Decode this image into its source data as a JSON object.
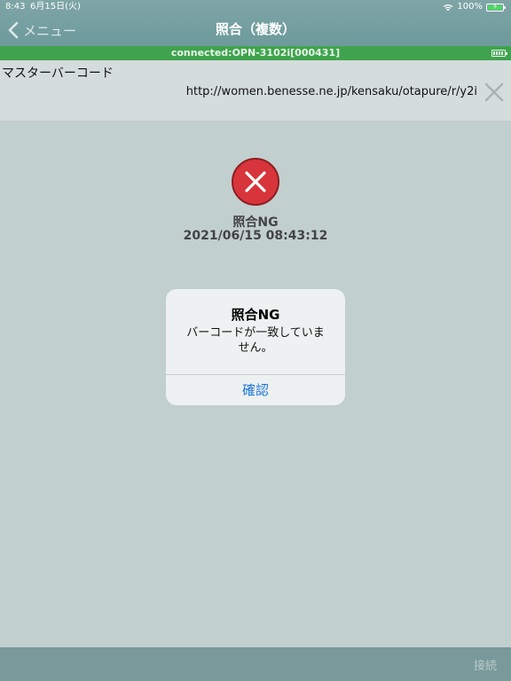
{
  "status_bar": {
    "time": "8:43",
    "date": "6月15日(火)",
    "battery_percent": "100%"
  },
  "nav": {
    "back_label": "メニュー",
    "title": "照合（複数）"
  },
  "connection": {
    "text": "connected:OPN-3102i[000431]"
  },
  "master": {
    "label": "マスターバーコード",
    "value": "http://women.benesse.ne.jp/kensaku/otapure/r/y2i"
  },
  "result": {
    "status": "照合NG",
    "timestamp": "2021/06/15 08:43:12"
  },
  "alert": {
    "title": "照合NG",
    "message": "バーコードが一致していません。",
    "confirm_label": "確認"
  },
  "bottom": {
    "connect_label": "接続"
  },
  "colors": {
    "nav_bar": "#6d9a9c",
    "connected_bar": "#3fa34d",
    "error": "#d7353b",
    "link": "#1b76d8",
    "background": "#c2cfcf"
  }
}
